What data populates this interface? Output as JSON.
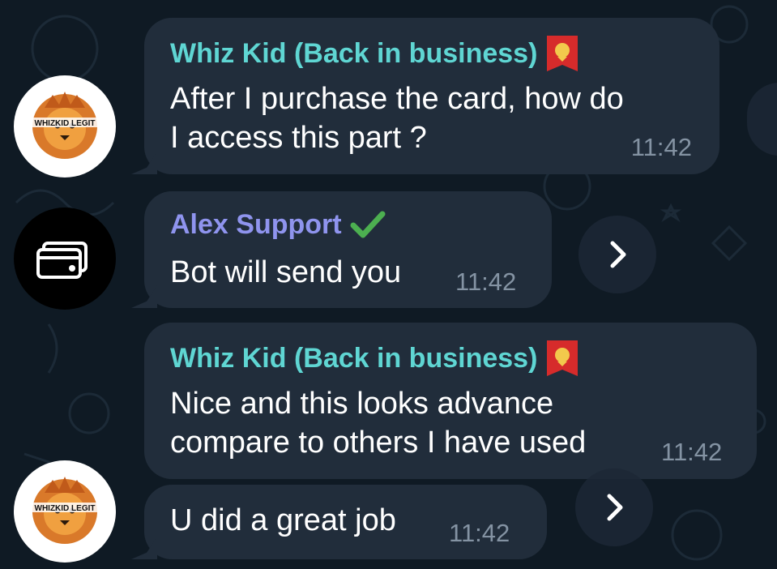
{
  "messages": [
    {
      "sender": "Whiz Kid (Back in business)",
      "lines": [
        "After I purchase the card, how do",
        "I access this part ?"
      ],
      "time": "11:42"
    },
    {
      "sender": "Alex Support",
      "lines": [
        "Bot will send you"
      ],
      "time": "11:42"
    },
    {
      "sender": "Whiz Kid (Back in business)",
      "lines": [
        "Nice and this looks advance",
        "compare to others I have used"
      ],
      "time": "11:42"
    },
    {
      "sender": "",
      "lines": [
        "U did a great job"
      ],
      "time": "11:42"
    }
  ],
  "avatars": {
    "whiz_logo_text": "WHIZKID LEGIT",
    "alex_icon": "credit-card-icon"
  },
  "icons": {
    "forward": "chevron-right-icon",
    "verified": "check-mark-icon",
    "flag": "red-lion-flag-icon"
  },
  "colors": {
    "background": "#0f1a24",
    "bubble": "#212d3b",
    "whiz_name": "#5fd6d3",
    "alex_name": "#8f94ee",
    "time": "#8493a3"
  }
}
